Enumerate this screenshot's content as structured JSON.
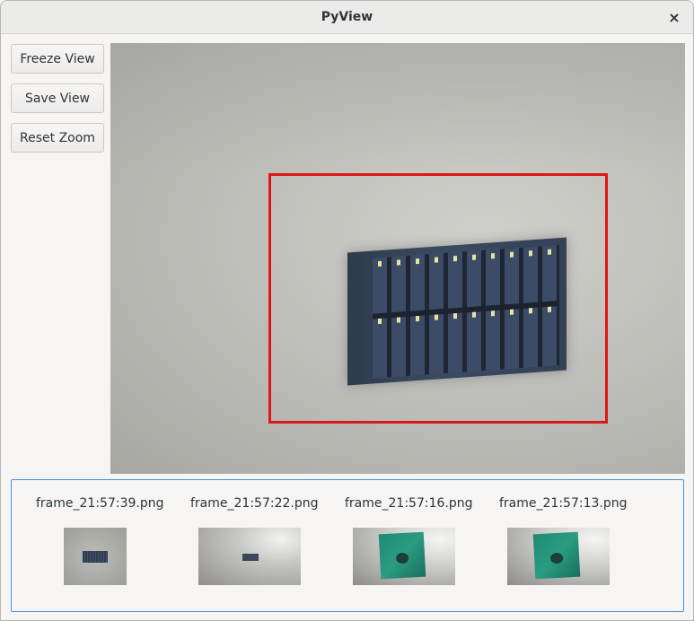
{
  "window": {
    "title": "PyView",
    "close_icon": "×"
  },
  "sidebar": {
    "buttons": [
      {
        "label": "Freeze View"
      },
      {
        "label": "Save View"
      },
      {
        "label": "Reset Zoom"
      }
    ]
  },
  "view": {
    "roi_color": "#e01515"
  },
  "gallery": {
    "border_color": "#4a90d9",
    "items": [
      {
        "filename": "frame_21:57:39.png"
      },
      {
        "filename": "frame_21:57:22.png"
      },
      {
        "filename": "frame_21:57:16.png"
      },
      {
        "filename": "frame_21:57:13.png"
      }
    ]
  }
}
